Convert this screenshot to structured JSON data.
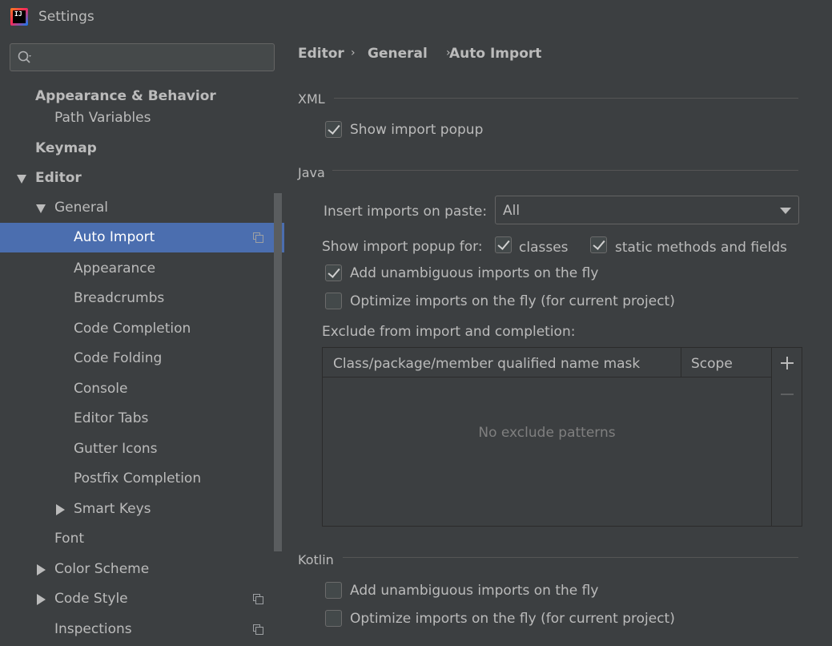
{
  "window": {
    "title": "Settings",
    "app_icon_text": "IJ"
  },
  "search": {
    "placeholder": ""
  },
  "sidebar": {
    "items": [
      {
        "label": "Appearance & Behavior"
      },
      {
        "label": "Path Variables"
      },
      {
        "label": "Keymap"
      },
      {
        "label": "Editor"
      },
      {
        "label": "General"
      },
      {
        "label": "Auto Import"
      },
      {
        "label": "Appearance"
      },
      {
        "label": "Breadcrumbs"
      },
      {
        "label": "Code Completion"
      },
      {
        "label": "Code Folding"
      },
      {
        "label": "Console"
      },
      {
        "label": "Editor Tabs"
      },
      {
        "label": "Gutter Icons"
      },
      {
        "label": "Postfix Completion"
      },
      {
        "label": "Smart Keys"
      },
      {
        "label": "Font"
      },
      {
        "label": "Color Scheme"
      },
      {
        "label": "Code Style"
      },
      {
        "label": "Inspections"
      }
    ]
  },
  "breadcrumb": {
    "items": [
      "Editor",
      "General",
      "Auto Import"
    ],
    "separator": "›"
  },
  "xml": {
    "title": "XML",
    "show_import_popup": {
      "label": "Show import popup",
      "checked": true
    }
  },
  "java": {
    "title": "Java",
    "insert_imports_label": "Insert imports on paste:",
    "insert_imports_value": "All",
    "show_popup_for_label": "Show import popup for:",
    "classes": {
      "label": "classes",
      "checked": true
    },
    "static_methods": {
      "label": "static methods and fields",
      "checked": true
    },
    "add_unambiguous": {
      "label": "Add unambiguous imports on the fly",
      "checked": true
    },
    "optimize_imports": {
      "label": "Optimize imports on the fly (for current project)",
      "checked": false
    },
    "exclude_label": "Exclude from import and completion:",
    "table": {
      "columns": [
        "Class/package/member qualified name mask",
        "Scope"
      ],
      "empty_text": "No exclude patterns"
    }
  },
  "kotlin": {
    "title": "Kotlin",
    "add_unambiguous": {
      "label": "Add unambiguous imports on the fly",
      "checked": false
    },
    "optimize_imports": {
      "label": "Optimize imports on the fly (for current project)",
      "checked": false
    }
  },
  "colors": {
    "background": "#3c3f41",
    "selection": "#4b6eaf",
    "text": "#bbbbbb"
  }
}
